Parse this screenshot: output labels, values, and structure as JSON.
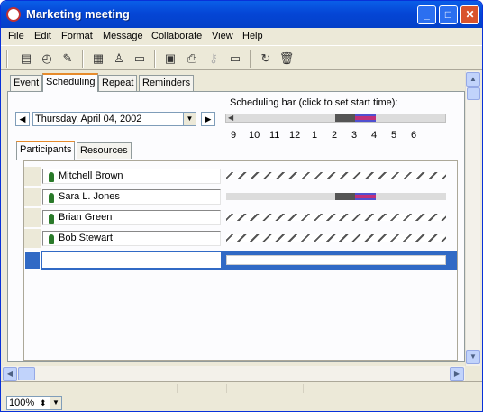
{
  "window": {
    "title": "Marketing meeting"
  },
  "menu": [
    "File",
    "Edit",
    "Format",
    "Message",
    "Collaborate",
    "View",
    "Help"
  ],
  "toolbar": [
    "new-meeting-icon",
    "reminder-icon",
    "edit-icon",
    "print-icon",
    "address-icon",
    "message-icon",
    "calendar-icon",
    "printer-icon",
    "key-icon",
    "folder-icon",
    "collaborate-icon",
    "trash-icon"
  ],
  "tabs": [
    "Event",
    "Scheduling",
    "Repeat",
    "Reminders"
  ],
  "active_tab": "Scheduling",
  "scheduling": {
    "date": "Thursday, April 04, 2002",
    "bar_label": "Scheduling bar (click to set start time):",
    "hours": [
      "9",
      "10",
      "11",
      "12",
      "1",
      "2",
      "3",
      "4",
      "5",
      "6"
    ]
  },
  "subtabs": [
    "Participants",
    "Resources"
  ],
  "participants": [
    {
      "name": "Mitchell Brown",
      "availability": "unavailable"
    },
    {
      "name": "Sara L. Jones",
      "availability": "busy"
    },
    {
      "name": "Brian Green",
      "availability": "unavailable"
    },
    {
      "name": "Bob Stewart",
      "availability": "unavailable"
    }
  ],
  "new_participant_value": "",
  "zoom": "100%",
  "colors": {
    "busy": "#555555",
    "meeting": "#c0307a",
    "selection": "#316ac5"
  }
}
